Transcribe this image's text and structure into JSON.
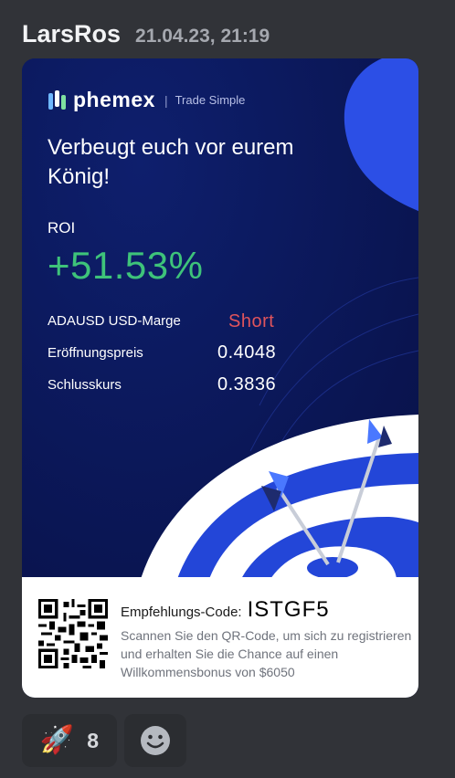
{
  "message": {
    "author": "LarsRos",
    "timestamp": "21.04.23, 21:19"
  },
  "card": {
    "brand_name": "phemex",
    "brand_separator": "|",
    "brand_tagline": "Trade Simple",
    "headline": "Verbeugt euch vor eurem König!",
    "roi_label": "ROI",
    "roi_value": "+51.53%",
    "roi_color": "#3ec37a",
    "stats": [
      {
        "label": "ADAUSD USD-Marge",
        "value": "Short",
        "value_color": "#e0545c"
      },
      {
        "label": "Eröffnungspreis",
        "value": "0.4048"
      },
      {
        "label": "Schlusskurs",
        "value": "0.3836"
      }
    ],
    "referral_label": "Empfehlungs-Code:",
    "referral_code": "ISTGF5",
    "referral_description": "Scannen Sie den QR-Code, um sich zu registrieren und erhalten Sie die Chance auf einen Willkommensbonus von $6050"
  },
  "reactions": [
    {
      "icon": "rocket-icon",
      "emoji": "🚀",
      "count": "8"
    },
    {
      "icon": "add-reaction-icon"
    }
  ],
  "colors": {
    "background": "#313338",
    "card_blue": "#0b1a5c",
    "accent_blue": "#2346d8",
    "short_red": "#e0545c",
    "roi_green": "#3ec37a"
  }
}
